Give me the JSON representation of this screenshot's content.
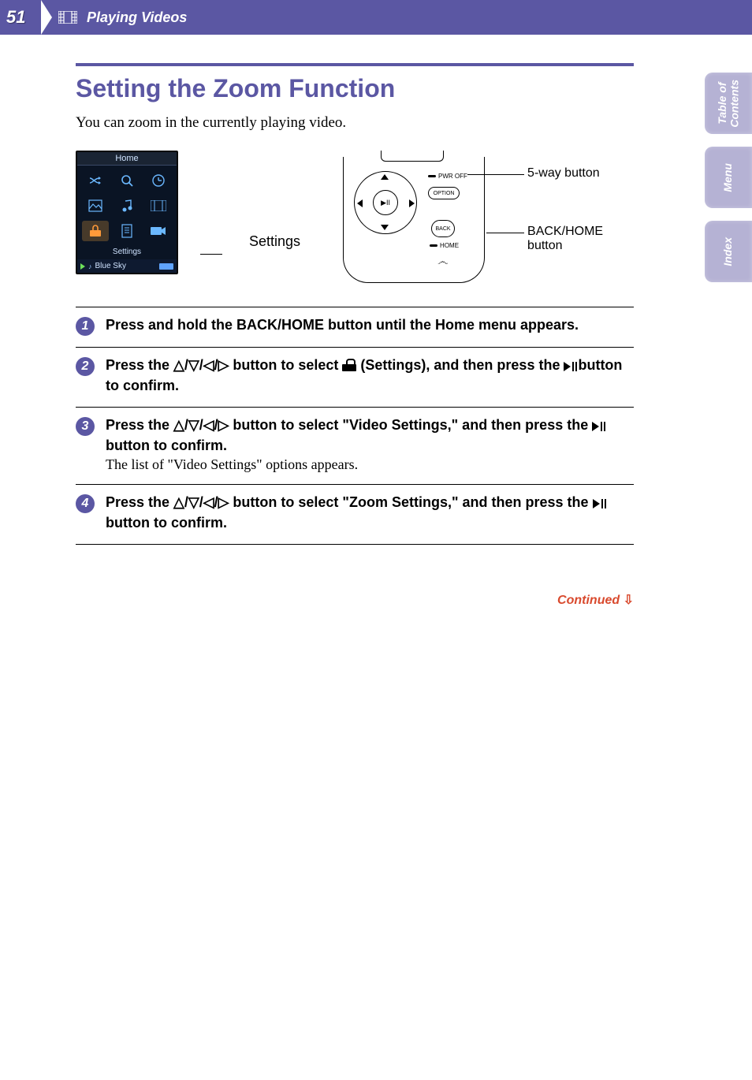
{
  "header": {
    "page_number": "51",
    "section_title": "Playing Videos"
  },
  "side_tabs": {
    "toc": "Table of\nContents",
    "menu": "Menu",
    "index": "Index"
  },
  "title": "Setting the Zoom Function",
  "intro": "You can zoom in the currently playing video.",
  "device_screen": {
    "header": "Home",
    "selected_label": "Settings",
    "now_playing_track": "Blue Sky"
  },
  "settings_callout": "Settings",
  "controls_callouts": {
    "five_way": "5-way button",
    "back_home": "BACK/HOME\nbutton",
    "pwr_off": "PWR OFF",
    "option": "OPTION",
    "back": "BACK",
    "home": "HOME",
    "play_pause": "▶II"
  },
  "steps": [
    {
      "num": "1",
      "bold": "Press and hold the BACK/HOME button until the Home menu appears."
    },
    {
      "num": "2",
      "bold_pre": "Press the ",
      "arrows": "△/▽/◁/▷",
      "bold_mid": " button to select ",
      "after_icon": " (Settings), and then press the ",
      "bold_tail": " button to confirm."
    },
    {
      "num": "3",
      "bold_pre": "Press the ",
      "arrows": "△/▽/◁/▷",
      "bold_mid": " button to select \"Video Settings,\" and then press the ",
      "bold_tail": " button to confirm.",
      "plain": "The list of \"Video Settings\" options appears."
    },
    {
      "num": "4",
      "bold_pre": "Press the ",
      "arrows": "△/▽/◁/▷",
      "bold_mid": " button to select \"Zoom Settings,\" and then press the ",
      "bold_tail": " button to confirm."
    }
  ],
  "continued": "Continued"
}
